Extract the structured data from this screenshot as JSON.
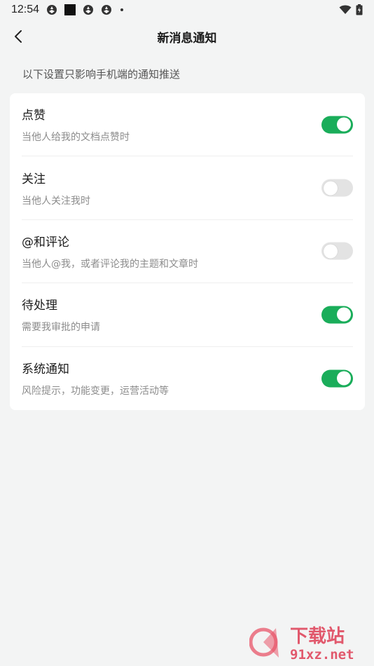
{
  "status_bar": {
    "time": "12:54",
    "icons": [
      "system-notification-icon",
      "app-square-icon",
      "system-notification-icon",
      "system-notification-icon",
      "dot-icon"
    ],
    "right_icons": [
      "wifi-icon",
      "battery-icon"
    ]
  },
  "header": {
    "back_icon": "back-arrow-icon",
    "title": "新消息通知"
  },
  "hint": "以下设置只影响手机端的通知推送",
  "settings": [
    {
      "title": "点赞",
      "description": "当他人给我的文档点赞时",
      "enabled": true
    },
    {
      "title": "关注",
      "description": "当他人关注我时",
      "enabled": false
    },
    {
      "title": "@和评论",
      "description": "当他人@我，或者评论我的主题和文章时",
      "enabled": false
    },
    {
      "title": "待处理",
      "description": "需要我审批的申请",
      "enabled": true
    },
    {
      "title": "系统通知",
      "description": "风险提示，功能变更，运营活动等",
      "enabled": true
    }
  ],
  "colors": {
    "toggle_on": "#1aad5a",
    "toggle_off": "#e3e3e3",
    "background": "#f3f4f4"
  },
  "watermark": {
    "brand": "下载站",
    "domain": "91xz.net"
  }
}
